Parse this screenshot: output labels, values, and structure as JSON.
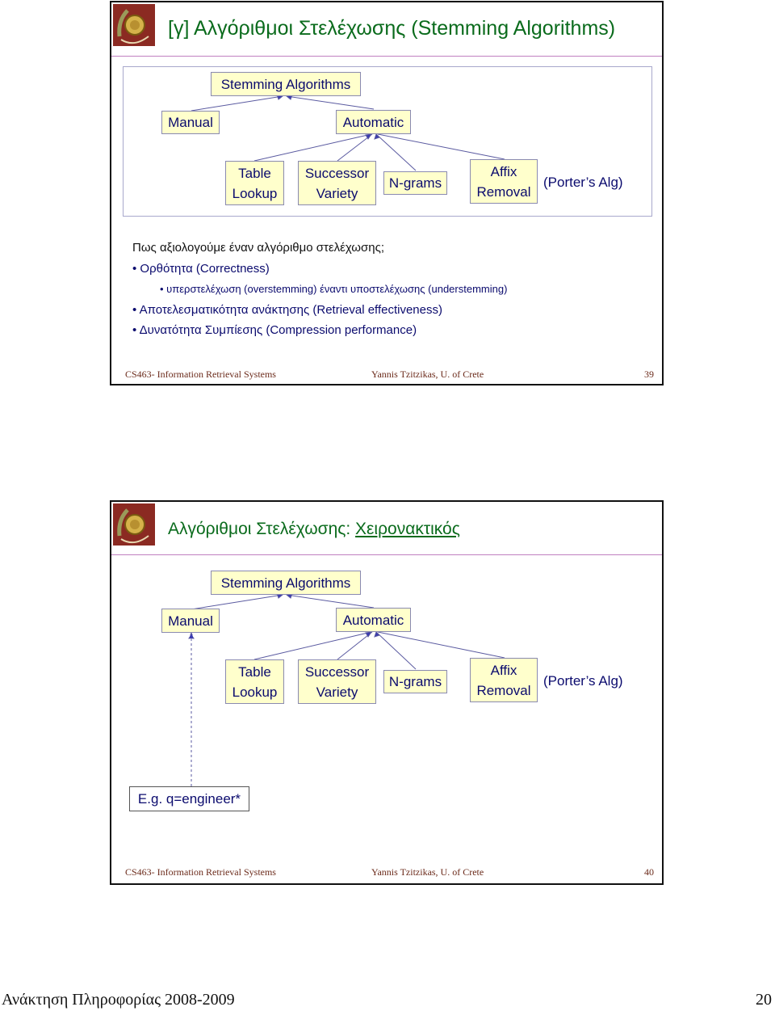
{
  "slides": [
    {
      "title": "[γ] Αλγόριθμοι Στελέχωσης (Stemming Algorithms)",
      "diagram": {
        "root": "Stemming  Algorithms",
        "manual": "Manual",
        "automatic": "Automatic",
        "table_lookup": [
          "Table",
          "Lookup"
        ],
        "successor_variety": [
          "Successor",
          "Variety"
        ],
        "ngrams": "N-grams",
        "affix_removal": [
          "Affix",
          "Removal"
        ],
        "porter_note": "(Porter’s Alg)"
      },
      "body": {
        "question": "Πως αξιολογούμε έναν αλγόριθμο στελέχωσης;",
        "bullets": [
          "Ορθότητα (Correctness)",
          "υπερστελέχωση (overstemming) έναντι υποστελέχωσης (understemming)",
          "Αποτελεσματικότητα ανάκτησης (Retrieval effectiveness)",
          "Δυνατότητα Συμπίεσης  (Compression performance)"
        ]
      },
      "footer": {
        "course": "CS463- Information Retrieval Systems",
        "author": "Yannis Tzitzikas, U. of Crete",
        "page": "39"
      }
    },
    {
      "title_prefix": "Αλγόριθμοι Στελέχωσης: ",
      "title_underlined": "Χειρονακτικός",
      "diagram": {
        "root": "Stemming  Algorithms",
        "manual": "Manual",
        "automatic": "Automatic",
        "table_lookup": [
          "Table",
          "Lookup"
        ],
        "successor_variety": [
          "Successor",
          "Variety"
        ],
        "ngrams": "N-grams",
        "affix_removal": [
          "Affix",
          "Removal"
        ],
        "porter_note": "(Porter’s Alg)",
        "example": "E.g.  q=engineer*"
      },
      "footer": {
        "course": "CS463- Information Retrieval Systems",
        "author": "Yannis Tzitzikas, U. of Crete",
        "page": "40"
      }
    }
  ],
  "page_footer": {
    "course_year": "Ανάκτηση Πληροφορίας 2008-2009",
    "page_number": "20"
  },
  "colors": {
    "title_green": "#0a6b1c",
    "node_fill": "#ffffcc",
    "node_text": "#0b0b6e",
    "footer_brown": "#6b2a1a",
    "logo_red": "#8b2a22"
  }
}
